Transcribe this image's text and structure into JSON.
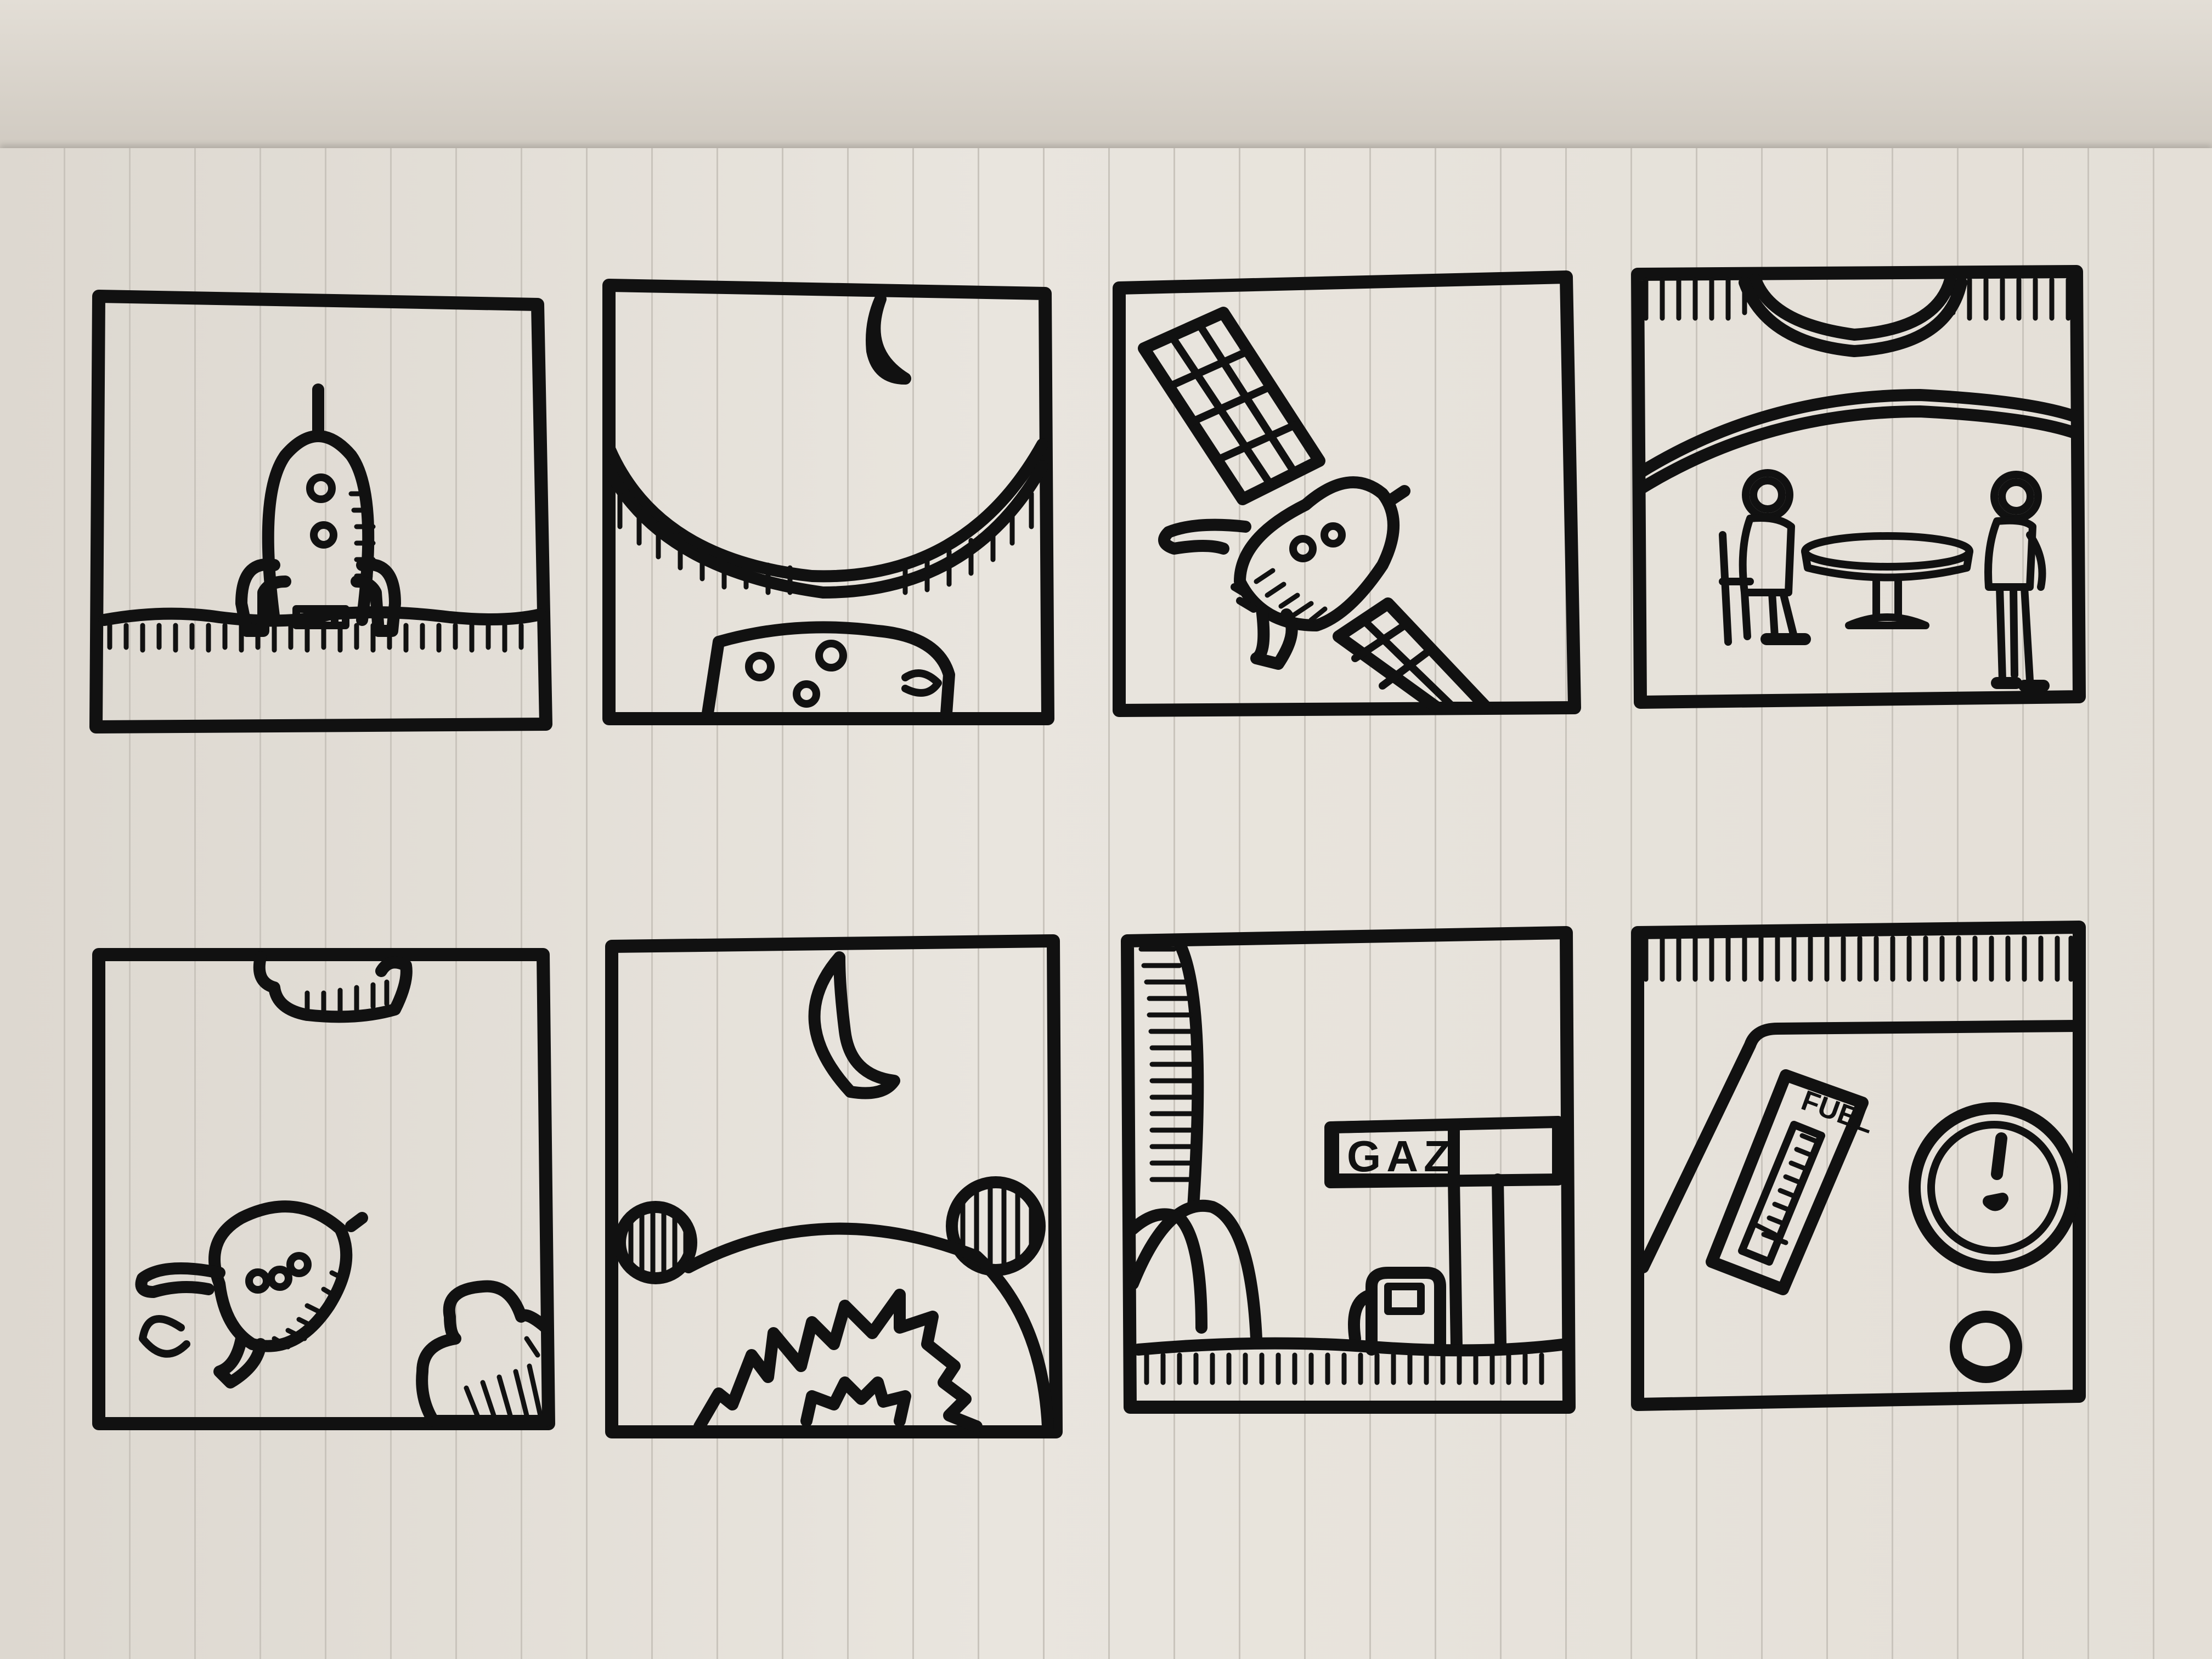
{
  "notebook": {
    "paper_color": "#e6e1d9",
    "ink_color": "#111111"
  },
  "panels": [
    {
      "id": 1,
      "scene": "rocket-on-ground"
    },
    {
      "id": 2,
      "scene": "planet-and-moon"
    },
    {
      "id": 3,
      "scene": "satellite"
    },
    {
      "id": 4,
      "scene": "station-interior"
    },
    {
      "id": 5,
      "scene": "rocket-and-asteroids"
    },
    {
      "id": 6,
      "scene": "moon-and-crater"
    },
    {
      "id": 7,
      "scene": "gas-station",
      "sign_text": "GAZ"
    },
    {
      "id": 8,
      "scene": "cockpit-dashboard",
      "gauge_label": "FUEL"
    }
  ]
}
